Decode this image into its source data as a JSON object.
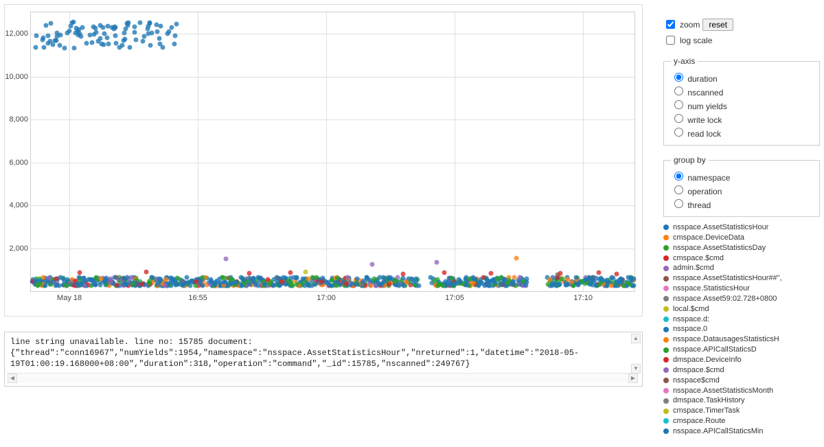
{
  "controls": {
    "zoom_label": "zoom",
    "zoom_checked": true,
    "reset_label": "reset",
    "logscale_label": "log scale",
    "logscale_checked": false
  },
  "yaxis_panel": {
    "legend": "y-axis",
    "options": [
      "duration",
      "nscanned",
      "num yields",
      "write lock",
      "read lock"
    ],
    "selected": "duration"
  },
  "groupby_panel": {
    "legend": "group by",
    "options": [
      "namespace",
      "operation",
      "thread"
    ],
    "selected": "namespace"
  },
  "legend_series": [
    {
      "label": "nsspace.AssetStatisticsHour",
      "color": "#1f77b4"
    },
    {
      "label": "cmspace.DeviceData",
      "color": "#ff7f0e"
    },
    {
      "label": "nsspace.AssetStatisticsDay",
      "color": "#2ca02c"
    },
    {
      "label": "cmspace.$cmd",
      "color": "#d62728"
    },
    {
      "label": "admin.$cmd",
      "color": "#9467bd"
    },
    {
      "label": "nsspace.AssetStatisticsHour##\",",
      "color": "#8c564b"
    },
    {
      "label": "nsspace.StatisticsHour",
      "color": "#e377c2"
    },
    {
      "label": "nsspace.Asset59:02.728+0800",
      "color": "#7f7f7f"
    },
    {
      "label": "local.$cmd",
      "color": "#bcbd22"
    },
    {
      "label": "nsspace.d:",
      "color": "#17becf"
    },
    {
      "label": "nsspace.0",
      "color": "#1f77b4"
    },
    {
      "label": "nsspace.DatausagesStatisticsH",
      "color": "#ff7f0e"
    },
    {
      "label": "nsspace.APICallStaticsD",
      "color": "#2ca02c"
    },
    {
      "label": "dmspace.DeviceInfo",
      "color": "#d62728"
    },
    {
      "label": "dmspace.$cmd",
      "color": "#9467bd"
    },
    {
      "label": "nsspace$cmd",
      "color": "#8c564b"
    },
    {
      "label": "nsspace.AssetStatisticsMonth",
      "color": "#e377c2"
    },
    {
      "label": "dmspace.TaskHistory",
      "color": "#7f7f7f"
    },
    {
      "label": "cmspace.TimerTask",
      "color": "#bcbd22"
    },
    {
      "label": "cmspace.Route",
      "color": "#17becf"
    },
    {
      "label": "nsspace.APICallStaticsMin",
      "color": "#1f77b4"
    }
  ],
  "log_text": "line string unavailable. line no: 15785 document:\n{\"thread\":\"conn16967\",\"numYields\":1954,\"namespace\":\"nsspace.AssetStatisticsHour\",\"nreturned\":1,\"datetime\":\"2018-05-19T01:00:19.168000+08:00\",\"duration\":318,\"operation\":\"command\",\"_id\":15785,\"nscanned\":249767}",
  "chart_data": {
    "type": "scatter",
    "title": "",
    "xlabel": "",
    "ylabel": "",
    "ylim": [
      0,
      13000
    ],
    "y_ticks": [
      2000,
      4000,
      6000,
      8000,
      10000,
      12000
    ],
    "y_tick_labels": [
      "2,000",
      "4,000",
      "6,000",
      "8,000",
      "10,000",
      "12,000"
    ],
    "x_range_minutes": [
      -1.5,
      22
    ],
    "x_ticks_minutes": [
      0,
      5,
      10,
      15,
      20
    ],
    "x_tick_labels": [
      "May 18",
      "16:55",
      "17:00",
      "17:05",
      "17:10"
    ],
    "x_origin_label": "2018-05-18 16:50",
    "bands_minutes": [
      {
        "start": -1.5,
        "end": 13.6
      },
      {
        "start": 14.0,
        "end": 17.8
      },
      {
        "start": 18.6,
        "end": 22.0
      }
    ],
    "cluster_high": {
      "series": "nsspace.AssetStatisticsHour",
      "color": "#1f77b4",
      "x_range_minutes": [
        -1.4,
        4.2
      ],
      "y_range": [
        11300,
        12600
      ],
      "approx_count": 90
    },
    "dense_low_band": {
      "y_range": [
        250,
        650
      ],
      "series_mix": [
        {
          "series": "nsspace.AssetStatisticsHour",
          "color": "#1f77b4",
          "weight": 0.6
        },
        {
          "series": "nsspace.AssetStatisticsDay",
          "color": "#2ca02c",
          "weight": 0.18
        },
        {
          "series": "cmspace.DeviceData",
          "color": "#ff7f0e",
          "weight": 0.1
        },
        {
          "series": "cmspace.$cmd",
          "color": "#d62728",
          "weight": 0.07
        },
        {
          "series": "admin.$cmd",
          "color": "#9467bd",
          "weight": 0.05
        }
      ],
      "approx_count": 950
    },
    "outliers": [
      {
        "x": 6.1,
        "y": 1500,
        "color": "#9467bd",
        "series": "admin.$cmd"
      },
      {
        "x": 11.8,
        "y": 1250,
        "color": "#9467bd",
        "series": "admin.$cmd"
      },
      {
        "x": 14.3,
        "y": 1350,
        "color": "#9467bd",
        "series": "admin.$cmd"
      },
      {
        "x": 17.4,
        "y": 1550,
        "color": "#ff7f0e",
        "series": "cmspace.DeviceData"
      },
      {
        "x": 9.2,
        "y": 900,
        "color": "#bcbd22",
        "series": "local.$cmd"
      },
      {
        "x": 0.4,
        "y": 850,
        "color": "#d62728",
        "series": "cmspace.$cmd"
      },
      {
        "x": 3.0,
        "y": 900,
        "color": "#d62728",
        "series": "cmspace.$cmd"
      },
      {
        "x": 7.0,
        "y": 820,
        "color": "#d62728",
        "series": "cmspace.$cmd"
      },
      {
        "x": 8.6,
        "y": 850,
        "color": "#d62728",
        "series": "cmspace.$cmd"
      },
      {
        "x": 13.0,
        "y": 800,
        "color": "#d62728",
        "series": "cmspace.$cmd"
      },
      {
        "x": 14.6,
        "y": 860,
        "color": "#d62728",
        "series": "cmspace.$cmd"
      },
      {
        "x": 16.4,
        "y": 840,
        "color": "#d62728",
        "series": "cmspace.$cmd"
      },
      {
        "x": 19.1,
        "y": 820,
        "color": "#d62728",
        "series": "cmspace.$cmd"
      },
      {
        "x": 20.6,
        "y": 850,
        "color": "#d62728",
        "series": "cmspace.$cmd"
      },
      {
        "x": 21.3,
        "y": 810,
        "color": "#d62728",
        "series": "cmspace.$cmd"
      },
      {
        "x": 19.0,
        "y": 780,
        "color": "#8c564b",
        "series": "nsspace.AssetStatisticsHour##\","
      }
    ]
  }
}
